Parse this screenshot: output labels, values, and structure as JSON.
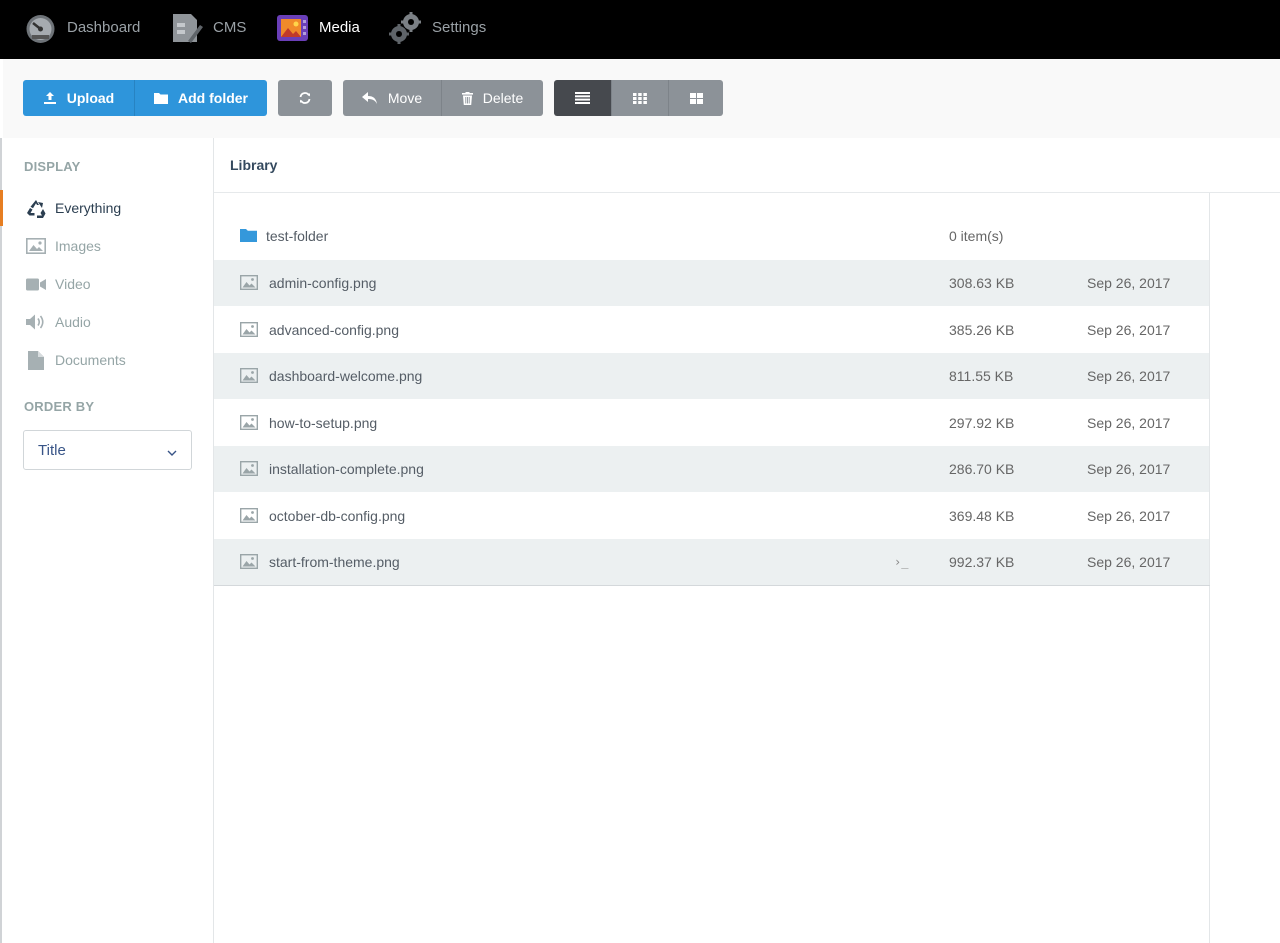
{
  "nav": {
    "items": [
      {
        "label": "Dashboard",
        "icon": "speedometer-icon",
        "active": false
      },
      {
        "label": "CMS",
        "icon": "cms-edit-icon",
        "active": false
      },
      {
        "label": "Media",
        "icon": "media-gallery-icon",
        "active": true
      },
      {
        "label": "Settings",
        "icon": "gears-icon",
        "active": false
      }
    ]
  },
  "toolbar": {
    "upload_label": "Upload",
    "add_folder_label": "Add folder",
    "refresh_icon": "refresh-icon",
    "move_label": "Move",
    "delete_label": "Delete",
    "view_modes": [
      "list-view-icon",
      "grid-small-icon",
      "grid-large-icon"
    ],
    "active_view": "list"
  },
  "sidebar": {
    "display_heading": "DISPLAY",
    "items": [
      {
        "label": "Everything",
        "icon": "recycle-icon",
        "active": true
      },
      {
        "label": "Images",
        "icon": "image-icon",
        "active": false
      },
      {
        "label": "Video",
        "icon": "video-camera-icon",
        "active": false
      },
      {
        "label": "Audio",
        "icon": "speaker-icon",
        "active": false
      },
      {
        "label": "Documents",
        "icon": "document-icon",
        "active": false
      }
    ],
    "order_heading": "ORDER BY",
    "order_value": "Title"
  },
  "library": {
    "title": "Library",
    "folder": {
      "name": "test-folder",
      "size": "0 item(s)",
      "date": ""
    },
    "files": [
      {
        "name": "admin-config.png",
        "size": "308.63 KB",
        "date": "Sep 26, 2017"
      },
      {
        "name": "advanced-config.png",
        "size": "385.26 KB",
        "date": "Sep 26, 2017"
      },
      {
        "name": "dashboard-welcome.png",
        "size": "811.55 KB",
        "date": "Sep 26, 2017"
      },
      {
        "name": "how-to-setup.png",
        "size": "297.92 KB",
        "date": "Sep 26, 2017"
      },
      {
        "name": "installation-complete.png",
        "size": "286.70 KB",
        "date": "Sep 26, 2017"
      },
      {
        "name": "october-db-config.png",
        "size": "369.48 KB",
        "date": "Sep 26, 2017"
      },
      {
        "name": "start-from-theme.png",
        "size": "992.37 KB",
        "date": "Sep 26, 2017"
      }
    ],
    "hover_cursor_glyph": "›_"
  },
  "colors": {
    "primary": "#2e95db",
    "grey_button": "#8c9298",
    "dark_button": "#56595e",
    "active_marker": "#e67e22",
    "row_alt": "#ecf0f1"
  }
}
